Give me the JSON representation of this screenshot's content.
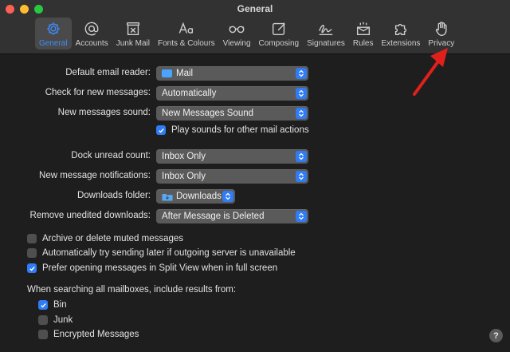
{
  "window": {
    "title": "General"
  },
  "toolbar": {
    "items": [
      {
        "label": "General",
        "icon": "gear-icon",
        "active": true
      },
      {
        "label": "Accounts",
        "icon": "at-icon"
      },
      {
        "label": "Junk Mail",
        "icon": "junk-mail-icon"
      },
      {
        "label": "Fonts & Colours",
        "icon": "fonts-icon"
      },
      {
        "label": "Viewing",
        "icon": "glasses-icon"
      },
      {
        "label": "Composing",
        "icon": "compose-icon"
      },
      {
        "label": "Signatures",
        "icon": "signature-icon"
      },
      {
        "label": "Rules",
        "icon": "rules-icon"
      },
      {
        "label": "Extensions",
        "icon": "puzzle-icon"
      },
      {
        "label": "Privacy",
        "icon": "hand-icon"
      }
    ]
  },
  "settings": {
    "default_reader": {
      "label": "Default email reader:",
      "value": "Mail"
    },
    "check_messages": {
      "label": "Check for new messages:",
      "value": "Automatically"
    },
    "messages_sound": {
      "label": "New messages sound:",
      "value": "New Messages Sound"
    },
    "play_sounds": {
      "label": "Play sounds for other mail actions",
      "checked": true
    },
    "dock_unread": {
      "label": "Dock unread count:",
      "value": "Inbox Only"
    },
    "notifications": {
      "label": "New message notifications:",
      "value": "Inbox Only"
    },
    "downloads_folder": {
      "label": "Downloads folder:",
      "value": "Downloads"
    },
    "remove_downloads": {
      "label": "Remove unedited downloads:",
      "value": "After Message is Deleted"
    }
  },
  "checks": [
    {
      "label": "Archive or delete muted messages",
      "checked": false
    },
    {
      "label": "Automatically try sending later if outgoing server is unavailable",
      "checked": false
    },
    {
      "label": "Prefer opening messages in Split View when in full screen",
      "checked": true
    }
  ],
  "search": {
    "heading": "When searching all mailboxes, include results from:",
    "items": [
      {
        "label": "Bin",
        "checked": true
      },
      {
        "label": "Junk",
        "checked": false
      },
      {
        "label": "Encrypted Messages",
        "checked": false
      }
    ]
  },
  "help": {
    "label": "?"
  },
  "colors": {
    "accent": "#2f7cf6",
    "arrow": "#e0201b",
    "background": "#1e1e1e"
  }
}
